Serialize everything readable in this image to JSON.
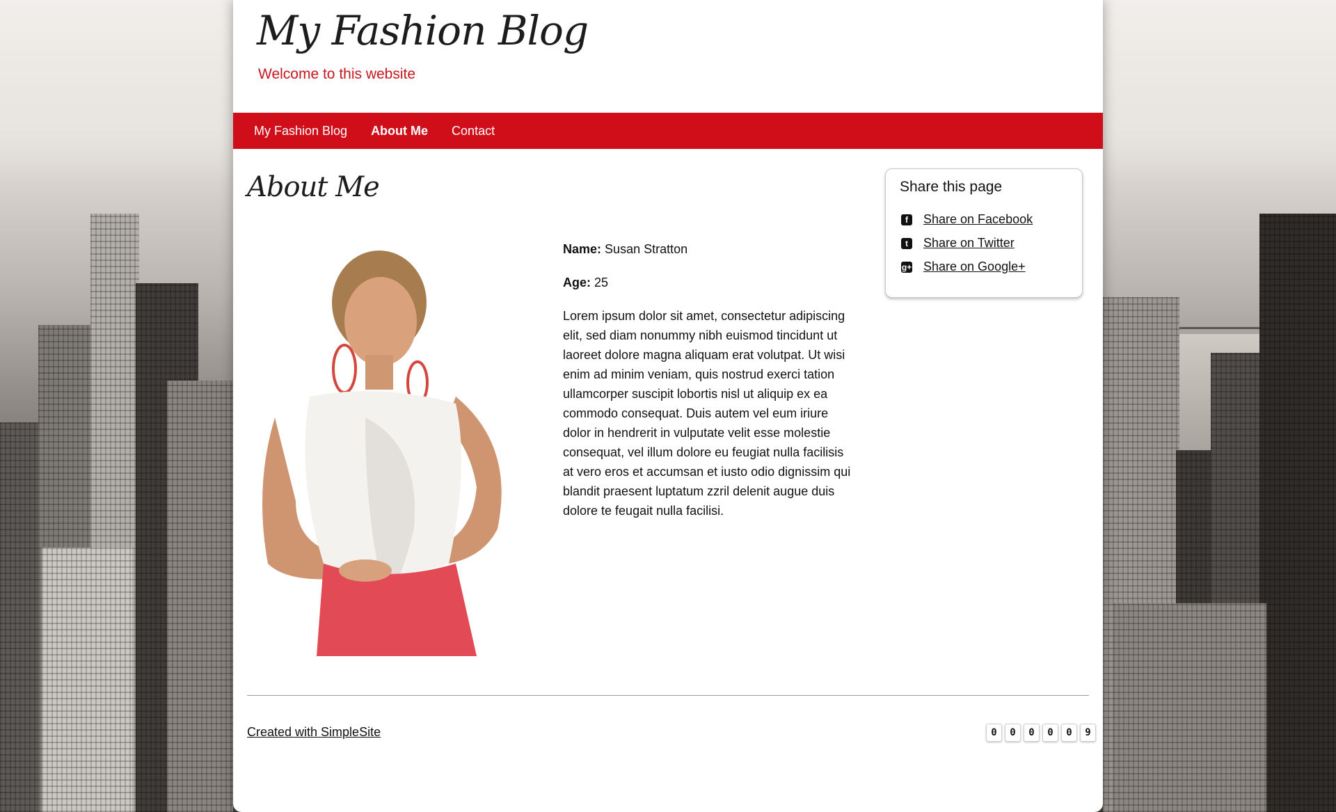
{
  "header": {
    "site_title": "My Fashion Blog",
    "subtitle": "Welcome to this website"
  },
  "nav": {
    "items": [
      {
        "label": "My Fashion Blog",
        "active": false
      },
      {
        "label": "About Me",
        "active": true
      },
      {
        "label": "Contact",
        "active": false
      }
    ]
  },
  "main": {
    "title": "About Me",
    "photo_icon": "portrait-photo",
    "bio": {
      "name_label": "Name:",
      "name_value": "Susan Stratton",
      "age_label": "Age:",
      "age_value": "25",
      "text": "Lorem ipsum dolor sit amet, consectetur adipiscing elit, sed diam nonummy nibh euismod tincidunt ut laoreet dolore magna aliquam erat volutpat. Ut wisi enim ad minim veniam, quis nostrud exerci tation ullamcorper suscipit lobortis nisl ut aliquip ex ea commodo consequat. Duis autem vel eum iriure dolor in hendrerit in vulputate velit esse molestie consequat, vel illum dolore eu feugiat nulla facilisis at vero eros et accumsan et iusto odio dignissim qui blandit praesent luptatum zzril delenit augue duis dolore te feugait nulla facilisi."
    }
  },
  "share": {
    "title": "Share this page",
    "links": [
      {
        "label": "Share on Facebook",
        "icon": "facebook-icon",
        "glyph": "f"
      },
      {
        "label": "Share on Twitter",
        "icon": "twitter-icon",
        "glyph": "t"
      },
      {
        "label": "Share on Google+",
        "icon": "googleplus-icon",
        "glyph": "g+"
      }
    ]
  },
  "footer": {
    "created_with": "Created with SimpleSite",
    "counter_digits": [
      "0",
      "0",
      "0",
      "0",
      "0",
      "9"
    ]
  },
  "colors": {
    "accent_red": "#cf0e1a",
    "subtitle_red": "#c8161e",
    "text": "#111111"
  }
}
